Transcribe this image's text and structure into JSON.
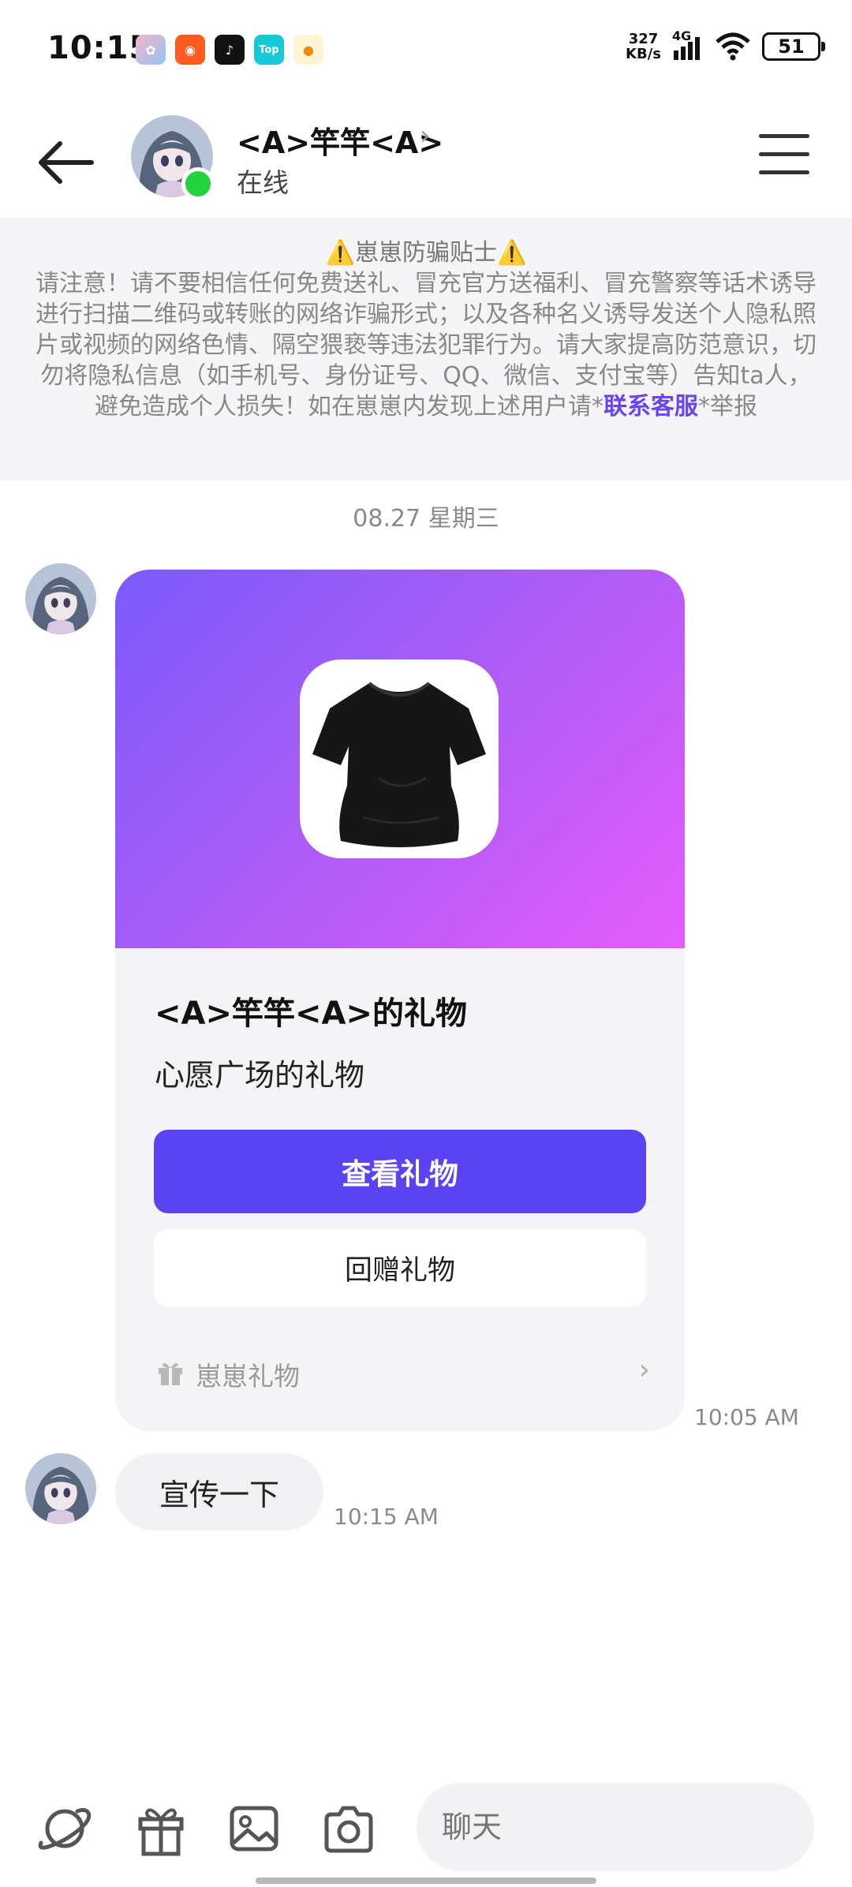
{
  "status_bar": {
    "time": "10:15",
    "net_speed_value": "327",
    "net_speed_unit": "KB/s",
    "network": "4G",
    "battery": "51",
    "app_icons": [
      "anime-app-icon",
      "kuaishou-icon",
      "tiktok-icon",
      "top-app-icon",
      "taobao-icon"
    ]
  },
  "header": {
    "contact_name": "<A>竿竿<A>",
    "chevron": "›",
    "status": "在线"
  },
  "notice": {
    "title": "⚠️崽崽防骗贴士⚠️",
    "body_before_link": "请注意！请不要相信任何免费送礼、冒充官方送福利、冒充警察等话术诱导进行扫描二维码或转账的网络诈骗形式；以及各种名义诱导发送个人隐私照片或视频的网络色情、隔空猥亵等违法犯罪行为。请大家提高防范意识，切勿将隐私信息（如手机号、身份证号、QQ、微信、支付宝等）告知ta人，避免造成个人损失！如在崽崽内发现上述用户请*",
    "link_text": "联系客服",
    "body_after_link": "*举报"
  },
  "date_separator": "08.27 星期三",
  "gift_card": {
    "title": "<A>竿竿<A>的礼物",
    "subtitle": "心愿广场的礼物",
    "view_button": "查看礼物",
    "return_button": "回赠礼物",
    "footer_label": "崽崽礼物",
    "footer_chevron": "›",
    "timestamp": "10:05 AM"
  },
  "text_message": {
    "text": "宣传一下",
    "timestamp": "10:15 AM"
  },
  "composer": {
    "placeholder": "聊天",
    "icons": [
      "planet-icon",
      "gift-icon",
      "image-icon",
      "camera-icon"
    ]
  },
  "colors": {
    "accent": "#5a43f2",
    "link": "#6a44ee",
    "online": "#22d33b",
    "gradient_start": "#7a5bfb",
    "gradient_end": "#e35cfc"
  }
}
